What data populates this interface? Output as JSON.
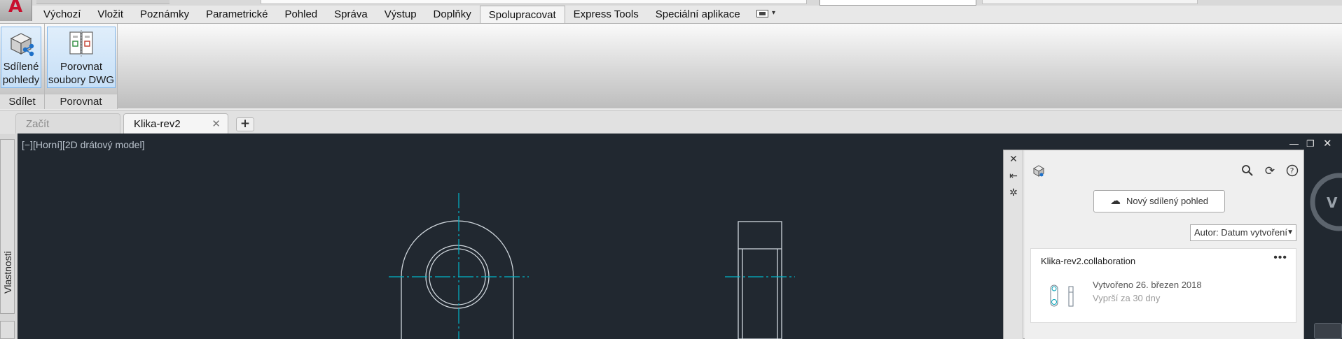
{
  "ribbon": {
    "tabs": [
      "Výchozí",
      "Vložit",
      "Poznámky",
      "Parametrické",
      "Pohled",
      "Správa",
      "Výstup",
      "Doplňky",
      "Spolupracovat",
      "Express Tools",
      "Speciální aplikace"
    ],
    "active_tab": "Spolupracovat",
    "panels": {
      "share": {
        "title": "Sdílet",
        "button_label_line1": "Sdílené",
        "button_label_line2": "pohledy"
      },
      "compare": {
        "title": "Porovnat",
        "button_label_line1": "Porovnat",
        "button_label_line2": "soubory DWG"
      }
    }
  },
  "document_tabs": {
    "start": "Začít",
    "active": "Klika-rev2"
  },
  "side_palette": {
    "label": "Vlastnosti"
  },
  "viewport": {
    "label": "[−][Horní][2D drátový model]"
  },
  "collaboration": {
    "new_view_button": "Nový sdílený pohled",
    "sort_select": "Autor: Datum vytvoření",
    "card": {
      "title": "Klika-rev2.collaboration",
      "created": "Vytvořeno 26. březen 2018",
      "expires": "Vyprší za 30 dny"
    }
  },
  "colors": {
    "canvas_bg": "#212830",
    "centerline": "#00b4c8",
    "geometry": "#cfd6dc",
    "accent_button": "#c6dff7"
  }
}
